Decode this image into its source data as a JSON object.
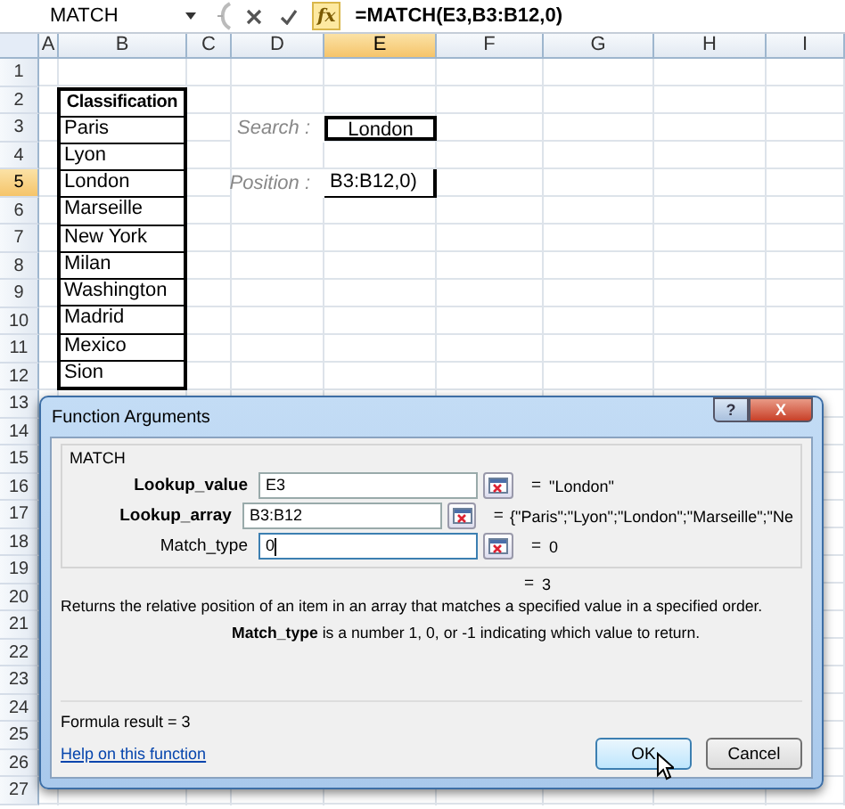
{
  "formula_bar": {
    "name_box": "MATCH",
    "fx": "fx",
    "formula": "=MATCH(E3,B3:B12,0)"
  },
  "sheet": {
    "columns": [
      {
        "label": "A",
        "selected": false
      },
      {
        "label": "B",
        "selected": false
      },
      {
        "label": "C",
        "selected": false
      },
      {
        "label": "D",
        "selected": false
      },
      {
        "label": "E",
        "selected": true
      },
      {
        "label": "F",
        "selected": false
      },
      {
        "label": "G",
        "selected": false
      },
      {
        "label": "H",
        "selected": false
      },
      {
        "label": "I",
        "selected": false
      }
    ],
    "rows": [
      {
        "label": "1",
        "selected": false
      },
      {
        "label": "2",
        "selected": false
      },
      {
        "label": "3",
        "selected": false
      },
      {
        "label": "4",
        "selected": false
      },
      {
        "label": "5",
        "selected": true
      },
      {
        "label": "6",
        "selected": false
      },
      {
        "label": "7",
        "selected": false
      },
      {
        "label": "8",
        "selected": false
      },
      {
        "label": "9",
        "selected": false
      },
      {
        "label": "10",
        "selected": false
      },
      {
        "label": "11",
        "selected": false
      },
      {
        "label": "12",
        "selected": false
      },
      {
        "label": "13",
        "selected": false
      },
      {
        "label": "14",
        "selected": false
      },
      {
        "label": "15",
        "selected": false
      },
      {
        "label": "16",
        "selected": false
      },
      {
        "label": "17",
        "selected": false
      },
      {
        "label": "18",
        "selected": false
      },
      {
        "label": "19",
        "selected": false
      },
      {
        "label": "20",
        "selected": false
      },
      {
        "label": "21",
        "selected": false
      },
      {
        "label": "22",
        "selected": false
      },
      {
        "label": "23",
        "selected": false
      },
      {
        "label": "24",
        "selected": false
      },
      {
        "label": "25",
        "selected": false
      },
      {
        "label": "26",
        "selected": false
      },
      {
        "label": "27",
        "selected": false
      }
    ],
    "table": {
      "header": "Classification",
      "items": [
        "Paris",
        "Lyon",
        "London",
        "Marseille",
        "New York",
        "Milan",
        "Washington",
        "Madrid",
        "Mexico",
        "Sion"
      ]
    },
    "search": {
      "label": "Search :",
      "value": "London"
    },
    "position": {
      "label": "Position :",
      "value": "B3:B12,0)",
      "editing": true
    }
  },
  "dialog": {
    "title": "Function Arguments",
    "title_buttons": [
      {
        "kind": "help",
        "label": "?"
      },
      {
        "kind": "close",
        "label": "X"
      }
    ],
    "function": "MATCH",
    "arguments": [
      {
        "name": "Lookup_value",
        "required": true,
        "value": "E3",
        "focused": false,
        "result": "\"London\""
      },
      {
        "name": "Lookup_array",
        "required": true,
        "value": "B3:B12",
        "focused": false,
        "result": "{\"Paris\";\"Lyon\";\"London\";\"Marseille\";\"Ne"
      },
      {
        "name": "Match_type",
        "required": false,
        "value": "0",
        "focused": true,
        "result": "0"
      }
    ],
    "equals": "=",
    "result": "3",
    "description": "Returns the relative position of an item in an array that matches a specified value in a specified order.",
    "argument_help": "**Match_type**  is a number 1, 0, or -1 indicating which value to return.",
    "formula_result": "Formula result =  3",
    "help_link": "Help on this function",
    "buttons": [
      {
        "label": "OK",
        "default": true
      },
      {
        "label": "Cancel",
        "default": false
      }
    ]
  }
}
